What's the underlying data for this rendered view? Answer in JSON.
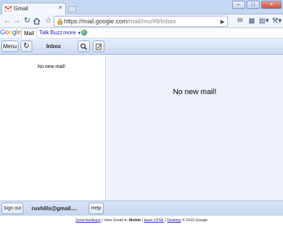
{
  "browser": {
    "tab_title": "Gmail",
    "tab_close": "×",
    "url_host": "https://mail.google.com",
    "url_rest": "/mail/mu/#tl/Inbox",
    "win_min": "–",
    "win_max": "□",
    "win_close": "×",
    "icons": [
      "back-icon",
      "forward-icon",
      "reload-icon",
      "home-icon",
      "star-icon",
      "lock-icon",
      "page-icon",
      "wrench-icon"
    ]
  },
  "gbar": {
    "logo_letters": [
      {
        "ch": "G",
        "color": "#2a5bd7"
      },
      {
        "ch": "o",
        "color": "#d63b2f"
      },
      {
        "ch": "o",
        "color": "#f0b400"
      },
      {
        "ch": "g",
        "color": "#2a5bd7"
      },
      {
        "ch": "l",
        "color": "#33a852"
      },
      {
        "ch": "e",
        "color": "#d63b2f"
      }
    ],
    "mail": "Mail",
    "talk": "Talk",
    "buzz": "Buzz",
    "more": "more",
    "more_arrow": "▼"
  },
  "header": {
    "menu": "Menu",
    "title": "Inbox"
  },
  "main": {
    "left_message": "No new mail!",
    "right_message": "No new mail!"
  },
  "footer": {
    "sign_out": "Sign out",
    "account": "rushills@gmail....",
    "help": "Help"
  },
  "bottom": {
    "send_feedback": "Send feedback",
    "sep1": " | View Gmail in: ",
    "mobile": "Mobile",
    "sep2": " | ",
    "basic_html": "basic HTML",
    "sep3": " | ",
    "desktop": "Desktop",
    "copyright": " © 2010 Google"
  },
  "colors": {
    "accent": "#1c1bb2",
    "header_bg": "#cbd9f3",
    "reading_pane_bg": "#edf2fb"
  }
}
